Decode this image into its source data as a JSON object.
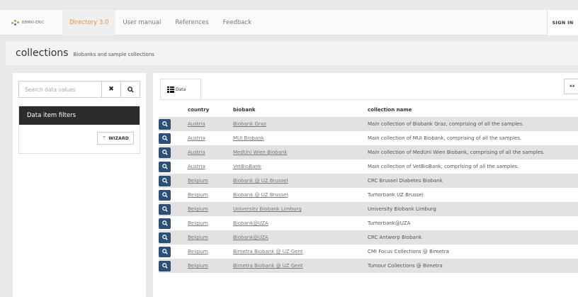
{
  "nav": {
    "logo_text": "BBMRI-ERIC",
    "tabs": [
      {
        "label": "Directory 3.0",
        "active": true
      },
      {
        "label": "User manual",
        "active": false
      },
      {
        "label": "References",
        "active": false
      },
      {
        "label": "Feedback",
        "active": false
      }
    ],
    "signin_label": "SIGN IN"
  },
  "header": {
    "title": "collections",
    "subtitle": "Biobanks and sample collections"
  },
  "sidebar": {
    "search_placeholder": "Search data values",
    "filters_title": "Data item filters",
    "wizard_label": "WIZARD"
  },
  "main": {
    "tab_label": "Data",
    "columns": [
      "country",
      "biobank",
      "collection name"
    ],
    "rows": [
      {
        "country": "Austria",
        "biobank": "Biobank Graz",
        "collection": "Main collection of Biobank Graz, comprising of all the samples."
      },
      {
        "country": "Austria",
        "biobank": "MUI Biobank",
        "collection": "Main collection of MUI Biobank, comprising of all the samples."
      },
      {
        "country": "Austria",
        "biobank": "MedUni Wien Biobank",
        "collection": "Main collection of MedUni Wien Biobank, comprising of all the samples."
      },
      {
        "country": "Austria",
        "biobank": "VetBioBank",
        "collection": "Main collection of VetBioBank, comprising of all the samples."
      },
      {
        "country": "Belgium",
        "biobank": "Biobank @ UZ Brussel",
        "collection": "CRC Brussel Diabetes Biobank"
      },
      {
        "country": "Belgium",
        "biobank": "Biobank @ UZ Brussel",
        "collection": "Tumorbank UZ Brussel"
      },
      {
        "country": "Belgium",
        "biobank": "University Biobank Limburg",
        "collection": "University Biobank Limburg"
      },
      {
        "country": "Belgium",
        "biobank": "Biobank@UZA",
        "collection": "Tumorbank@UZA"
      },
      {
        "country": "Belgium",
        "biobank": "Biobank@UZA",
        "collection": "CRC Antwerp Biobank"
      },
      {
        "country": "Belgium",
        "biobank": "Bimetra Biobank @ UZ Gent",
        "collection": "CMI Focus Collections @ Bimetra"
      },
      {
        "country": "Belgium",
        "biobank": "Bimetra Biobank @ UZ Gent",
        "collection": "Tumour Collections @ Bimetra"
      }
    ]
  },
  "colors": {
    "accent": "#e8913a",
    "view_button": "#2c4f78",
    "filters_header": "#2c2c2c"
  }
}
